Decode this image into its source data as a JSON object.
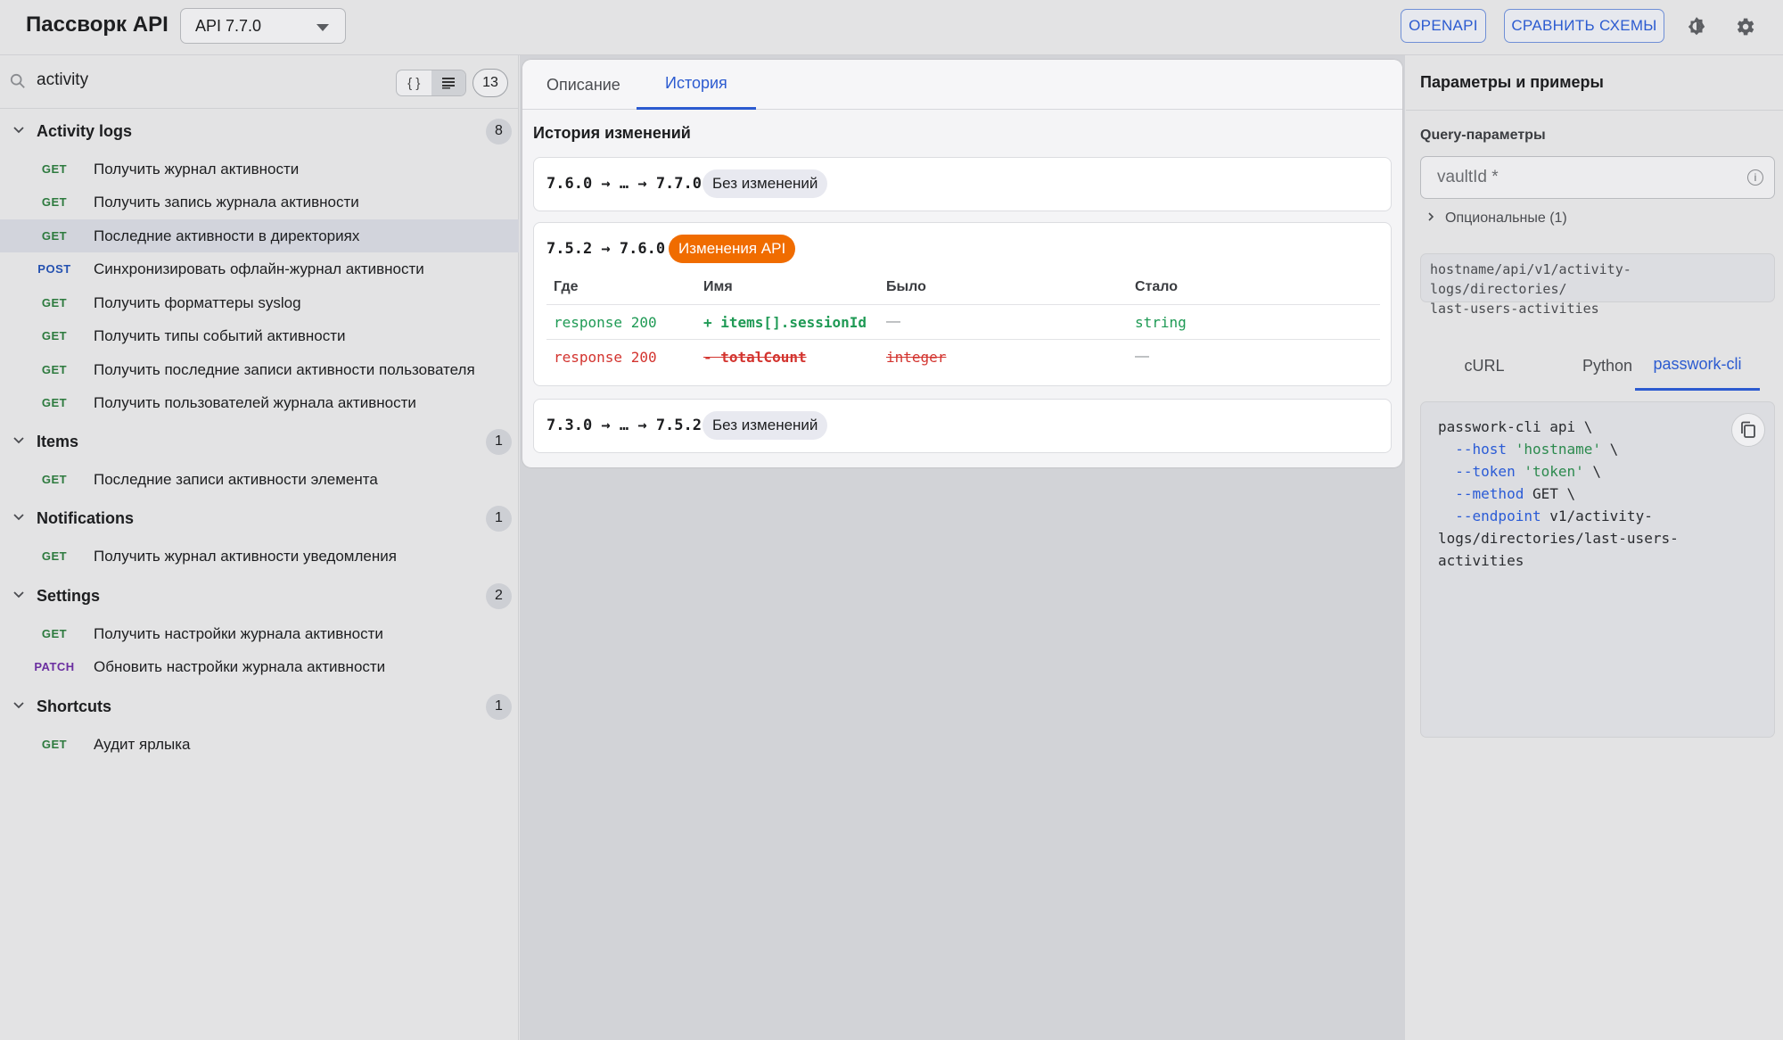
{
  "header": {
    "app_title": "Пассворк API",
    "version_selected": "API 7.7.0",
    "openapi_button": "OPENAPI",
    "compare_button": "СРАВНИТЬ СХЕМЫ"
  },
  "sidebar": {
    "search_value": "activity",
    "total_count": "13",
    "groups": [
      {
        "name": "Activity logs",
        "count": "8",
        "endpoints": [
          {
            "method": "GET",
            "label": "Получить журнал активности"
          },
          {
            "method": "GET",
            "label": "Получить запись журнала активности"
          },
          {
            "method": "GET",
            "label": "Последние активности в директориях"
          },
          {
            "method": "POST",
            "label": "Синхронизировать офлайн-журнал активности"
          },
          {
            "method": "GET",
            "label": "Получить форматтеры syslog"
          },
          {
            "method": "GET",
            "label": "Получить типы событий активности"
          },
          {
            "method": "GET",
            "label": "Получить последние записи активности пользователя"
          },
          {
            "method": "GET",
            "label": "Получить пользователей журнала активности"
          }
        ]
      },
      {
        "name": "Items",
        "count": "1",
        "endpoints": [
          {
            "method": "GET",
            "label": "Последние записи активности элемента"
          }
        ]
      },
      {
        "name": "Notifications",
        "count": "1",
        "endpoints": [
          {
            "method": "GET",
            "label": "Получить журнал активности уведомления"
          }
        ]
      },
      {
        "name": "Settings",
        "count": "2",
        "endpoints": [
          {
            "method": "GET",
            "label": "Получить настройки журнала активности"
          },
          {
            "method": "PATCH",
            "label": "Обновить настройки журнала активности"
          }
        ]
      },
      {
        "name": "Shortcuts",
        "count": "1",
        "endpoints": [
          {
            "method": "GET",
            "label": "Аудит ярлыка"
          }
        ]
      }
    ]
  },
  "center": {
    "tabs": [
      "Описание",
      "История"
    ],
    "history_title": "История изменений",
    "versions": [
      {
        "range": "7.6.0 → … → 7.7.0",
        "badge": "Без изменений"
      },
      {
        "range": "7.5.2 → 7.6.0",
        "badge": "Изменения API",
        "columns": [
          "Где",
          "Имя",
          "Было",
          "Стало"
        ],
        "rows": [
          {
            "where": "response 200",
            "name": "+ items[].sessionId",
            "was": "—",
            "now": "string"
          },
          {
            "where": "response 200",
            "name": "- totalCount",
            "was": "integer",
            "now": "—"
          }
        ]
      },
      {
        "range": "7.3.0 → … → 7.5.2",
        "badge": "Без изменений"
      }
    ]
  },
  "right": {
    "title": "Параметры и примеры",
    "query_title": "Query-параметры",
    "param_placeholder": "vaultId *",
    "optional_label": "Опциональные (1)",
    "url_line1": "hostname/api/v1/activity-logs/directories/",
    "url_line2": "last-users-activities",
    "code_tabs": [
      "cURL",
      "Python",
      "passwork-cli"
    ],
    "code": {
      "l1": "passwork-cli api \\",
      "host_flag": "--host",
      "host_val": "'hostname'",
      "token_flag": "--token",
      "token_val": "'token'",
      "method_flag": "--method",
      "method_val": "GET \\",
      "endpoint_flag": "--endpoint",
      "endpoint_val1": "v1/activity-",
      "endpoint_val2": "logs/directories/last-users-",
      "endpoint_val3": "activities",
      "cont": "\\"
    }
  }
}
